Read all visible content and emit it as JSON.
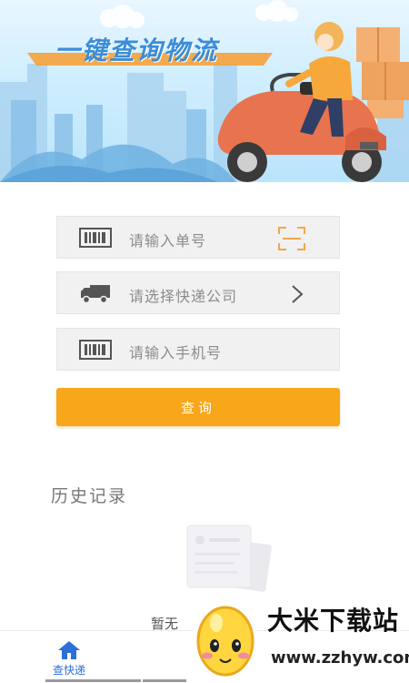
{
  "banner": {
    "title": "一键查询物流"
  },
  "form": {
    "number_placeholder": "请输入单号",
    "company_placeholder": "请选择快递公司",
    "phone_placeholder": "请输入手机号",
    "query_button": "查询"
  },
  "history": {
    "title": "历史记录",
    "empty_text": "暂无"
  },
  "bottom_nav": {
    "home_label": "查快递"
  },
  "watermark": {
    "name": "大米下载站",
    "url": "www.zzhyw.com"
  },
  "colors": {
    "accent": "#f8a61a",
    "nav_active": "#2d6ed8",
    "row_bg": "#f1f1f1",
    "scan_icon": "#f4a64a"
  },
  "icons": {
    "number": "barcode-icon",
    "company": "truck-icon",
    "phone": "barcode-icon",
    "scan": "scan-frame-icon",
    "chevron": "chevron-right-icon",
    "home": "home-icon"
  }
}
